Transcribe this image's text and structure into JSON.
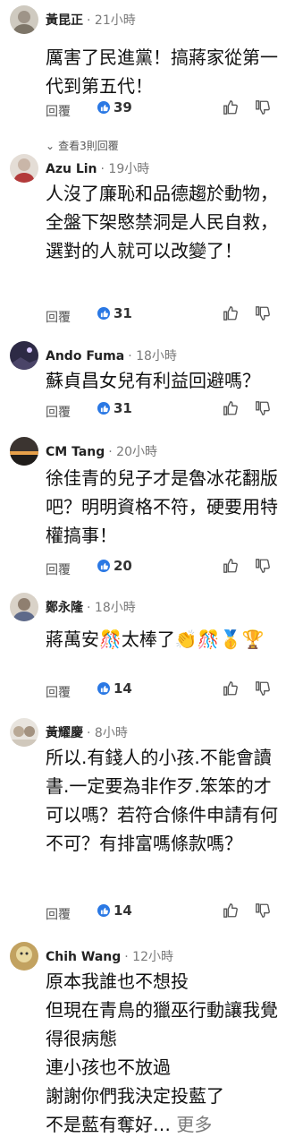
{
  "comments": [
    {
      "author": "黃昆正",
      "time": "21小時",
      "text": "厲害了民進黨！搞蔣家從第一代到第五代！",
      "reply_label": "回覆",
      "likes": "39",
      "avatar_color": "#b9b4a8"
    },
    {
      "author": "Azu Lin",
      "time": "19小時",
      "text": "人沒了廉恥和品德趨於動物，全盤下架愍禁洞是人民自救，選對的人就可以改變了！",
      "reply_label": "回覆",
      "likes": "31",
      "avatar_color": "#d8d0c8"
    },
    {
      "author": "Ando Fuma",
      "time": "18小時",
      "text": "蘇貞昌女兒有利益回避嗎？",
      "reply_label": "回覆",
      "likes": "31",
      "avatar_color": "#3a3350"
    },
    {
      "author": "CM Tang",
      "time": "20小時",
      "text": "徐佳青的兒子才是魯冰花翻版吧？明明資格不符，硬要用特權搞事！",
      "reply_label": "回覆",
      "likes": "20",
      "avatar_color": "#5a5048"
    },
    {
      "author": "鄭永隆",
      "time": "18小時",
      "text": "蔣萬安🎊太棒了👏🎊🥇🏆",
      "reply_label": "回覆",
      "likes": "14",
      "avatar_color": "#a89888"
    },
    {
      "author": "黃耀慶",
      "time": "8小時",
      "text": "所以.有錢人的小孩.不能會讀書.一定要為非作歹.笨笨的才可以嗎？若符合條件申請有何不可？有排富嗎條款嗎？",
      "reply_label": "回覆",
      "likes": "14",
      "avatar_color": "#c8c0b8"
    },
    {
      "author": "Chih Wang",
      "time": "12小時",
      "text": "原本我誰也不想投\n但現在青鳥的獵巫行動讓我覺得很病態\n連小孩也不放過\n謝謝你們我決定投藍了\n不是藍有奪好… ",
      "more_label": "更多",
      "avatar_color": "#b8a070"
    }
  ],
  "view_replies_label": "查看3則回覆",
  "colors": {
    "like_badge": "#2a78e4",
    "meta_gray": "#7a7a7a"
  }
}
